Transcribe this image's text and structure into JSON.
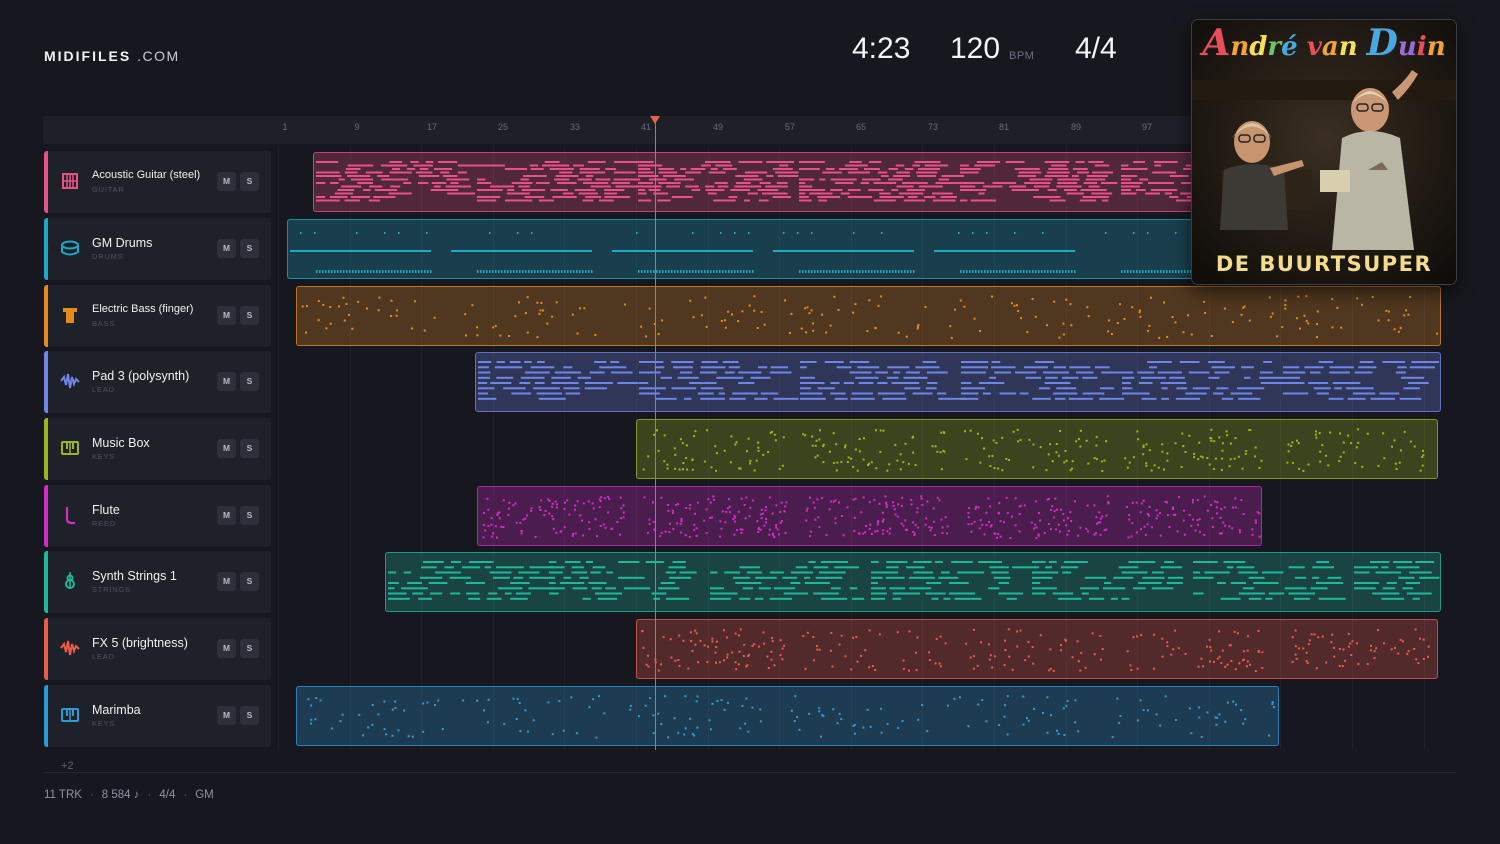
{
  "brand": {
    "name": "MIDIFILES",
    "domain": ".COM"
  },
  "header": {
    "time": "4:23",
    "bpm": "120",
    "bpm_unit": "BPM",
    "signature": "4/4"
  },
  "ruler": {
    "ticks": [
      "1",
      "9",
      "17",
      "25",
      "33",
      "41",
      "49",
      "57",
      "65",
      "73",
      "81",
      "89",
      "97"
    ]
  },
  "tracks": [
    {
      "name": "Acoustic Guitar (steel)",
      "category": "GUITAR",
      "icon": "guitar-icon",
      "color": "#e8508a",
      "mute": "M",
      "solo": "S"
    },
    {
      "name": "GM Drums",
      "category": "DRUMS",
      "icon": "drum-icon",
      "color": "#1fa7c7",
      "mute": "M",
      "solo": "S"
    },
    {
      "name": "Electric Bass (finger)",
      "category": "BASS",
      "icon": "bass-icon",
      "color": "#e68a1f",
      "mute": "M",
      "solo": "S"
    },
    {
      "name": "Pad 3 (polysynth)",
      "category": "LEAD",
      "icon": "wave-icon",
      "color": "#6f86e8",
      "mute": "M",
      "solo": "S"
    },
    {
      "name": "Music Box",
      "category": "KEYS",
      "icon": "keys-icon",
      "color": "#9bb71e",
      "mute": "M",
      "solo": "S"
    },
    {
      "name": "Flute",
      "category": "REED",
      "icon": "flute-icon",
      "color": "#d52bc8",
      "mute": "M",
      "solo": "S"
    },
    {
      "name": "Synth Strings 1",
      "category": "STRINGS",
      "icon": "violin-icon",
      "color": "#1fb89a",
      "mute": "M",
      "solo": "S"
    },
    {
      "name": "FX 5 (brightness)",
      "category": "LEAD",
      "icon": "wave-icon",
      "color": "#ec5b4a",
      "mute": "M",
      "solo": "S"
    },
    {
      "name": "Marimba",
      "category": "KEYS",
      "icon": "keys-icon",
      "color": "#2f9ad8",
      "mute": "M",
      "solo": "S"
    }
  ],
  "more_tracks": "+2",
  "footer": {
    "tracks": "11 TRK",
    "notes": "8 584 ♪",
    "signature": "4/4",
    "standard": "GM"
  },
  "album": {
    "artist": "André van Duin",
    "title": "DE BUURTSUPER"
  }
}
